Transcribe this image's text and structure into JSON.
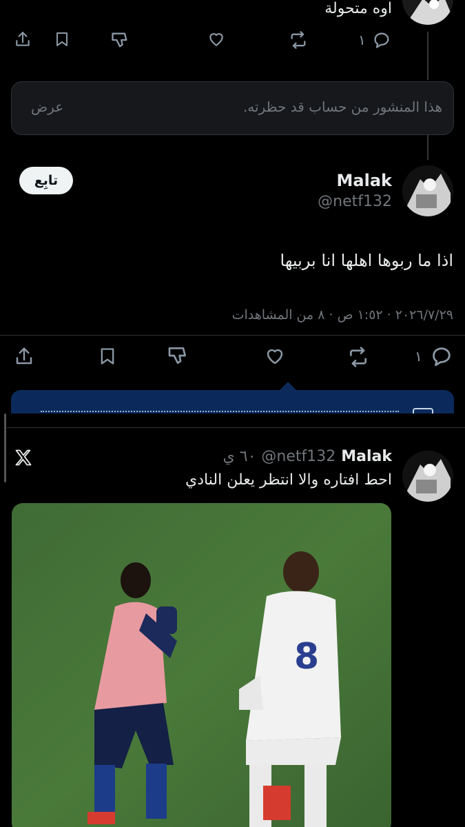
{
  "top_reply": {
    "text": "اوه متحولة",
    "reply_count": "١"
  },
  "blocked_notice": {
    "text": "هذا المنشور من حساب قد حظرته.",
    "view_label": "عرض"
  },
  "main_post": {
    "name": "Malak",
    "handle": "@netf132",
    "follow_label": "تابِع",
    "text": "اذا ما ربوها اهلها انا بربيها",
    "meta": "٢٠٢٦/٧/٢٩ · ١:٥٢ ص · ٨ من المشاهدات",
    "reply_count": "١"
  },
  "embedded_post": {
    "name": "Malak",
    "handle": "@netf132",
    "time": "٦٠ ي",
    "text": "احط افتاره والا انتظر يعلن النادي"
  },
  "colors": {
    "background": "#000000",
    "text": "#e7e9ea",
    "muted": "#71767b",
    "accent_banner": "#0b2a5b"
  }
}
